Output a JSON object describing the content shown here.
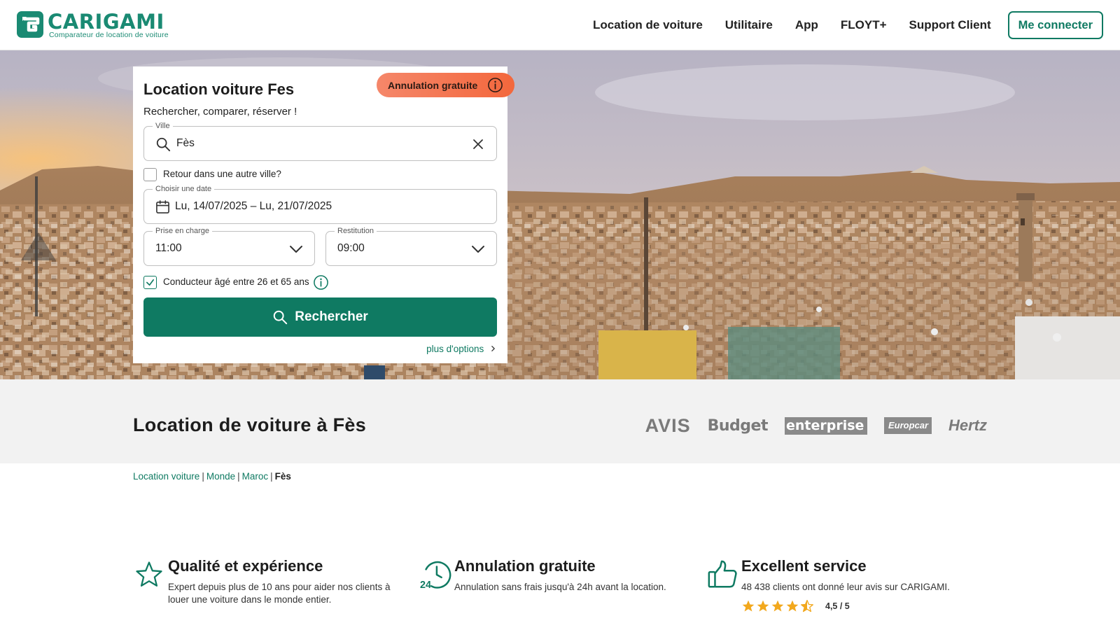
{
  "header": {
    "brand": "CARIGAMI",
    "tagline": "Comparateur de location de voiture",
    "nav": [
      "Location de voiture",
      "Utilitaire",
      "App",
      "FLOYT+",
      "Support Client"
    ],
    "login": "Me connecter"
  },
  "search": {
    "badge": "Annulation gratuite",
    "title": "Location voiture Fes",
    "subtitle": "Rechercher, comparer, réserver !",
    "city_label": "Ville",
    "city_value": "Fès",
    "return_other_city": "Retour dans une autre ville?",
    "return_other_city_checked": false,
    "date_label": "Choisir une date",
    "date_value": "Lu, 14/07/2025 – Lu, 21/07/2025",
    "pickup_label": "Prise en charge",
    "pickup_value": "11:00",
    "return_label": "Restitution",
    "return_value": "09:00",
    "driver_age": "Conducteur âgé entre 26 et 65 ans",
    "driver_age_checked": true,
    "search_button": "Rechercher",
    "more_options": "plus d'options"
  },
  "band": {
    "title": "Location de voiture à Fès",
    "brands": [
      "AVIS",
      "Budget",
      "enterprise",
      "Europcar",
      "Hertz"
    ]
  },
  "breadcrumb": {
    "items": [
      "Location voiture",
      "Monde",
      "Maroc"
    ],
    "current": "Fès"
  },
  "features": [
    {
      "icon": "star-icon",
      "title": "Qualité et expérience",
      "text": "Expert depuis plus de 10 ans pour aider nos clients à louer une voiture dans le monde entier."
    },
    {
      "icon": "clock-24-icon",
      "title": "Annulation gratuite",
      "text": "Annulation sans frais jusqu'à 24h avant la location."
    },
    {
      "icon": "thumbs-up-icon",
      "title": "Excellent service",
      "text": "48 438 clients ont donné leur avis sur CARIGAMI."
    }
  ],
  "rating": {
    "stars": 4.5,
    "text": "4,5 / 5"
  },
  "colors": {
    "brand": "#1a8a73",
    "primary": "#0f7a62",
    "badge": "#f3673c",
    "band": "#f2f2f2"
  }
}
